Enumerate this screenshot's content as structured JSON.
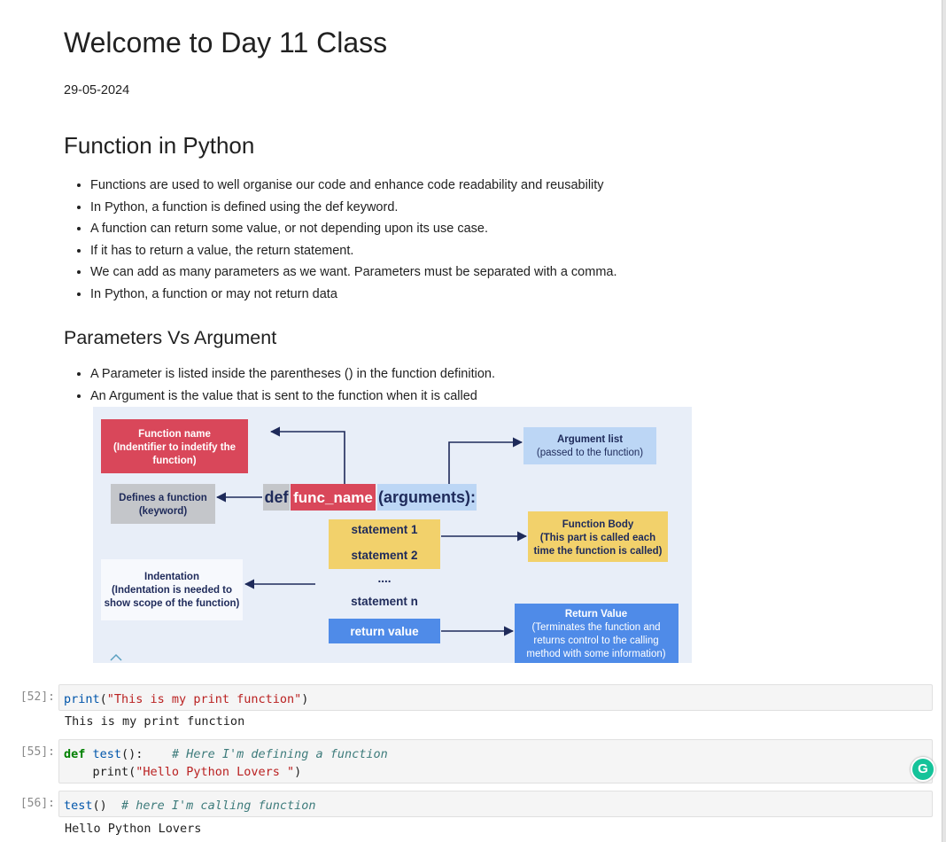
{
  "notebook": {
    "title": "Welcome to Day 11 Class",
    "date": "29-05-2024",
    "section1": {
      "heading": "Function in Python",
      "bullets": [
        "Functions are used to well organise our code and enhance code readability and reusability",
        "In Python, a function is defined using the def keyword.",
        "A function can return some value, or not depending upon its use case.",
        "If it has to return a value, the return statement.",
        "We can add as many parameters as we want. Parameters must be separated with a comma.",
        "In Python, a function or may not return data"
      ]
    },
    "section2": {
      "heading": "Parameters Vs Argument",
      "bullets": [
        "A Parameter is listed inside the parentheses () in the function definition.",
        "An Argument is the value that is sent to the function when it is called"
      ]
    }
  },
  "diagram": {
    "function_name_title": "Function name",
    "function_name_sub1": "(Indentifier to indetify the",
    "function_name_sub2": "function)",
    "defines_1": "Defines a function",
    "defines_2": "(keyword)",
    "def_kw": "def",
    "func_name": "func_name",
    "arguments": "(arguments):",
    "argument_list_1": "Argument list",
    "argument_list_2": "(passed to the function)",
    "statement1": "statement 1",
    "statement2": "statement 2",
    "dots": "....",
    "statementn": "statement n",
    "return_value": "return value",
    "body_1": "Function Body",
    "body_2": "(This part is called each",
    "body_3": "time the function is called)",
    "indent_1": "Indentation",
    "indent_2": "(Indentation is needed to",
    "indent_3": "show scope of the function)",
    "ret_1": "Return Value",
    "ret_2": "(Terminates the function and",
    "ret_3": "returns control to the calling",
    "ret_4": "method with some information)",
    "colors": {
      "background": "#e8eef8",
      "red": "#d9475a",
      "yellow": "#f2d16b",
      "blue": "#4f8be8",
      "lightblue": "#bcd6f5",
      "gray": "#c4c6ca",
      "navy": "#1e2a5a"
    }
  },
  "cells": [
    {
      "prompt": "[52]:",
      "code": {
        "fn": "print",
        "p1": "(",
        "str": "\"This is my print function\"",
        "p2": ")"
      },
      "output": "This is my print function"
    },
    {
      "prompt": "[55]:",
      "code": {
        "kw": "def",
        "sp": " ",
        "fn": "test",
        "paren": "():    ",
        "comment": "# Here I'm defining a function",
        "indent": "    ",
        "fn2": "print",
        "p1": "(",
        "str": "\"Hello Python Lovers \"",
        "p2": ")"
      }
    },
    {
      "prompt": "[56]:",
      "code": {
        "fn": "test",
        "paren": "()  ",
        "comment": "# here I'm calling function"
      },
      "output": "Hello Python Lovers"
    }
  ],
  "grammarly": {
    "icon": "grammarly-icon",
    "glyph": "G"
  }
}
